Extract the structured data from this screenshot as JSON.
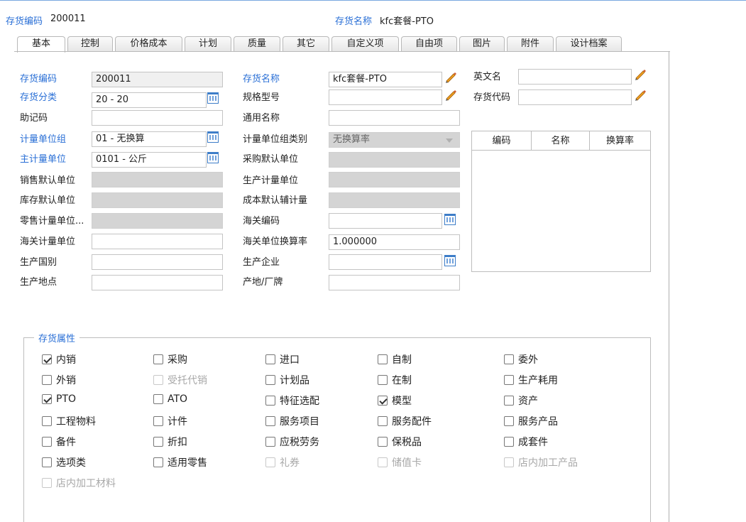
{
  "header": {
    "code_label": "存货编码",
    "code_value": "200011",
    "name_label": "存货名称",
    "name_value": "kfc套餐-PTO"
  },
  "tabs": [
    "基本",
    "控制",
    "价格成本",
    "计划",
    "质量",
    "其它",
    "自定义项",
    "自由项",
    "图片",
    "附件",
    "设计档案"
  ],
  "form": {
    "inv_code": {
      "label": "存货编码",
      "value": "200011"
    },
    "inv_class": {
      "label": "存货分类",
      "value": "20 - 20"
    },
    "mnemonic": {
      "label": "助记码",
      "value": ""
    },
    "uom_group": {
      "label": "计量单位组",
      "value": "01 - 无换算"
    },
    "main_uom": {
      "label": "主计量单位",
      "value": "0101 - 公斤"
    },
    "sales_uom": {
      "label": "销售默认单位",
      "value": ""
    },
    "stock_uom": {
      "label": "库存默认单位",
      "value": ""
    },
    "retail_uom": {
      "label": "零售计量单位...",
      "value": ""
    },
    "customs_uom": {
      "label": "海关计量单位",
      "value": ""
    },
    "origin_country": {
      "label": "生产国别",
      "value": ""
    },
    "origin_place": {
      "label": "生产地点",
      "value": ""
    },
    "inv_name": {
      "label": "存货名称",
      "value": "kfc套餐-PTO"
    },
    "spec": {
      "label": "规格型号",
      "value": ""
    },
    "common_name": {
      "label": "通用名称",
      "value": ""
    },
    "uom_group_type": {
      "label": "计量单位组类别",
      "value": "无换算率"
    },
    "purchase_uom": {
      "label": "采购默认单位",
      "value": ""
    },
    "production_uom": {
      "label": "生产计量单位",
      "value": ""
    },
    "cost_uom": {
      "label": "成本默认辅计量",
      "value": ""
    },
    "customs_code": {
      "label": "海关编码",
      "value": ""
    },
    "customs_rate": {
      "label": "海关单位换算率",
      "value": "1.000000"
    },
    "manufacturer": {
      "label": "生产企业",
      "value": ""
    },
    "brand": {
      "label": "产地/厂牌",
      "value": ""
    },
    "english_name": {
      "label": "英文名",
      "value": ""
    },
    "inv_alias": {
      "label": "存货代码",
      "value": ""
    }
  },
  "grid": {
    "columns": [
      "编码",
      "名称",
      "换算率"
    ]
  },
  "attributes": {
    "legend": "存货属性",
    "items": [
      {
        "label": "内销",
        "checked": true,
        "disabled": false
      },
      {
        "label": "采购",
        "checked": false,
        "disabled": false
      },
      {
        "label": "进口",
        "checked": false,
        "disabled": false
      },
      {
        "label": "自制",
        "checked": false,
        "disabled": false
      },
      {
        "label": "委外",
        "checked": false,
        "disabled": false
      },
      {
        "label": "外销",
        "checked": false,
        "disabled": false
      },
      {
        "label": "受托代销",
        "checked": false,
        "disabled": true
      },
      {
        "label": "计划品",
        "checked": false,
        "disabled": false
      },
      {
        "label": "在制",
        "checked": false,
        "disabled": false
      },
      {
        "label": "生产耗用",
        "checked": false,
        "disabled": false
      },
      {
        "label": "PTO",
        "checked": true,
        "disabled": false
      },
      {
        "label": "ATO",
        "checked": false,
        "disabled": false
      },
      {
        "label": "特征选配",
        "checked": false,
        "disabled": false
      },
      {
        "label": "模型",
        "checked": true,
        "disabled": false
      },
      {
        "label": "资产",
        "checked": false,
        "disabled": false
      },
      {
        "label": "工程物料",
        "checked": false,
        "disabled": false
      },
      {
        "label": "计件",
        "checked": false,
        "disabled": false
      },
      {
        "label": "服务项目",
        "checked": false,
        "disabled": false
      },
      {
        "label": "服务配件",
        "checked": false,
        "disabled": false
      },
      {
        "label": "服务产品",
        "checked": false,
        "disabled": false
      },
      {
        "label": "备件",
        "checked": false,
        "disabled": false
      },
      {
        "label": "折扣",
        "checked": false,
        "disabled": false
      },
      {
        "label": "应税劳务",
        "checked": false,
        "disabled": false
      },
      {
        "label": "保税品",
        "checked": false,
        "disabled": false
      },
      {
        "label": "成套件",
        "checked": false,
        "disabled": false
      },
      {
        "label": "选项类",
        "checked": false,
        "disabled": false
      },
      {
        "label": "适用零售",
        "checked": false,
        "disabled": false
      },
      {
        "label": "礼券",
        "checked": false,
        "disabled": true
      },
      {
        "label": "储值卡",
        "checked": false,
        "disabled": true
      },
      {
        "label": "店内加工产品",
        "checked": false,
        "disabled": true
      },
      {
        "label": "店内加工材料",
        "checked": false,
        "disabled": true
      }
    ]
  },
  "colors": {
    "accent": "#2a6fd6",
    "disabled_field": "#d4d4d4"
  }
}
